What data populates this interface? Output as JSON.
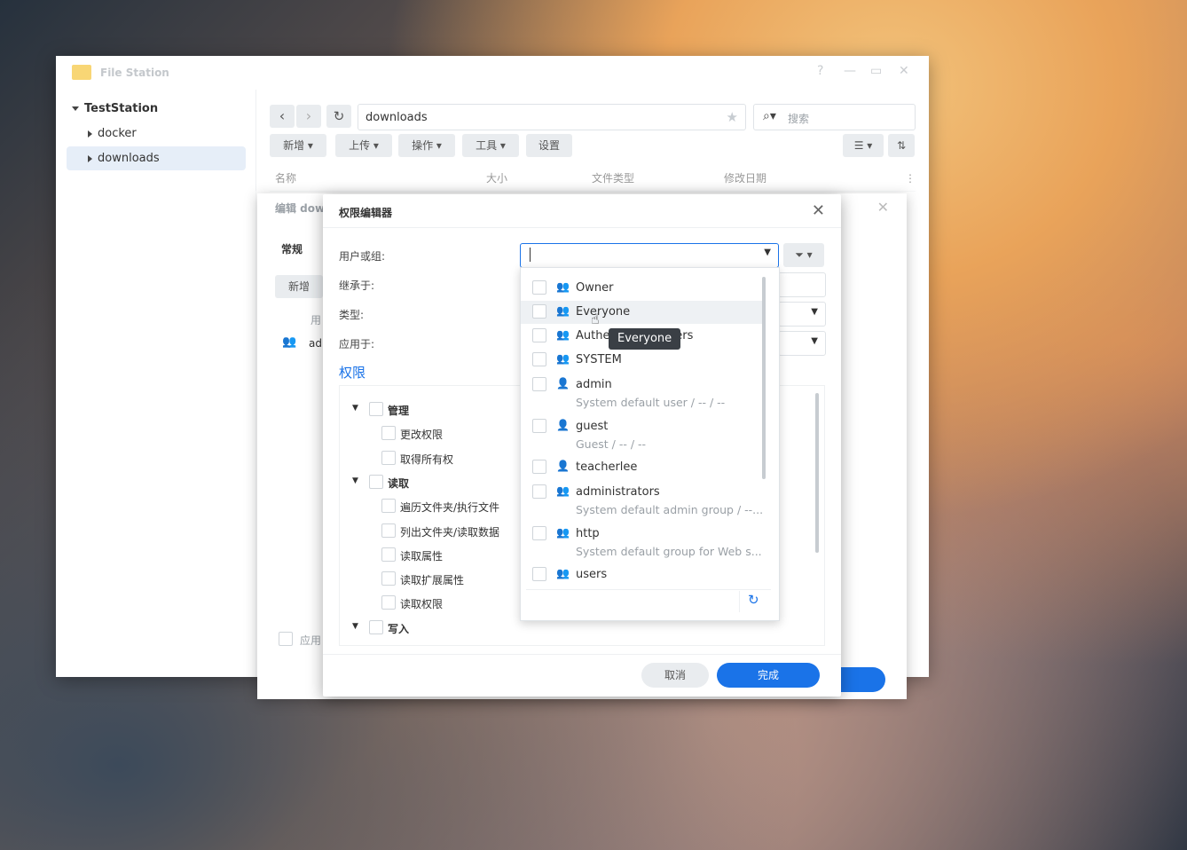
{
  "app": {
    "title": "File Station"
  },
  "window_controls": {
    "help": "?",
    "minimize": "—",
    "maximize": "▭",
    "close": "✕"
  },
  "sidebar": {
    "root": "TestStation",
    "items": [
      {
        "label": "docker"
      },
      {
        "label": "downloads"
      }
    ]
  },
  "toolbar": {
    "path": "downloads",
    "search_placeholder": "搜索",
    "buttons": {
      "create": "新增",
      "upload": "上传",
      "action": "操作",
      "tools": "工具",
      "settings": "设置"
    }
  },
  "file_table": {
    "columns": [
      "名称",
      "大小",
      "文件类型",
      "修改日期"
    ]
  },
  "props_window": {
    "title": "编辑 dow",
    "tab_general": "常规",
    "create_button": "新增",
    "col_user": "用",
    "row_user": "ad",
    "apply_label": "应用"
  },
  "modal": {
    "title": "权限编辑器",
    "fields": {
      "user_or_group": "用户或组:",
      "inherit_from": "继承于:",
      "type": "类型:",
      "apply_to": "应用于:"
    },
    "section_permissions": "权限",
    "permissions": [
      {
        "label": "管理",
        "bold": true,
        "children": [
          "更改权限",
          "取得所有权"
        ]
      },
      {
        "label": "读取",
        "bold": true,
        "children": [
          "遍历文件夹/执行文件",
          "列出文件夹/读取数据",
          "读取属性",
          "读取扩展属性",
          "读取权限"
        ]
      },
      {
        "label": "写入",
        "bold": true,
        "children": []
      }
    ],
    "cancel_button": "取消",
    "done_button": "完成"
  },
  "dropdown": {
    "items": [
      {
        "name": "Owner",
        "desc": "",
        "type": "group"
      },
      {
        "name": "Everyone",
        "desc": "",
        "type": "group"
      },
      {
        "name": "Authenticated Users",
        "desc": "",
        "type": "group"
      },
      {
        "name": "SYSTEM",
        "desc": "",
        "type": "group"
      },
      {
        "name": "admin",
        "desc": "System default user / -- / --",
        "type": "user"
      },
      {
        "name": "guest",
        "desc": "Guest / -- / --",
        "type": "user"
      },
      {
        "name": "teacherlee",
        "desc": "",
        "type": "user"
      },
      {
        "name": "administrators",
        "desc": "System default admin group / --...",
        "type": "group"
      },
      {
        "name": "http",
        "desc": "System default group for Web s...",
        "type": "group"
      },
      {
        "name": "users",
        "desc": "",
        "type": "group"
      }
    ]
  },
  "tooltip": {
    "text": "Everyone"
  },
  "colors": {
    "accent": "#1a73e8",
    "selected_bg": "#e6eef8"
  }
}
